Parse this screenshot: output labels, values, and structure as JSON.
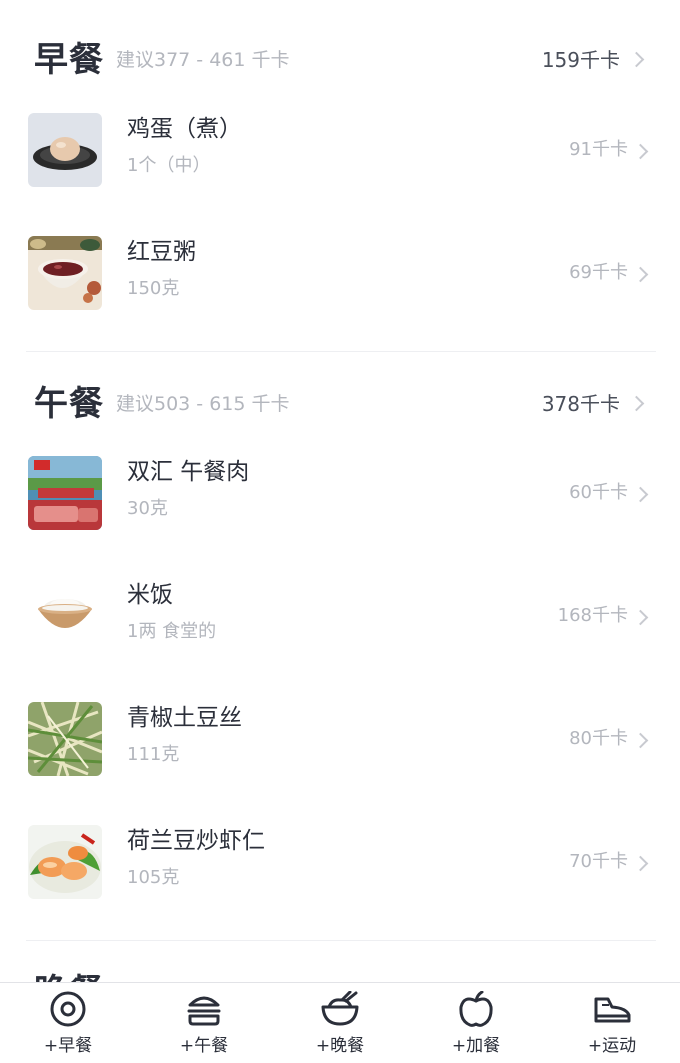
{
  "meals": {
    "breakfast": {
      "title": "早餐",
      "suggestion": "建议377 - 461 千卡",
      "total": "159千卡",
      "items": [
        {
          "name": "鸡蛋（煮）",
          "amount": "1个（中）",
          "kcal": "91千卡"
        },
        {
          "name": "红豆粥",
          "amount": "150克",
          "kcal": "69千卡"
        }
      ]
    },
    "lunch": {
      "title": "午餐",
      "suggestion": "建议503 - 615 千卡",
      "total": "378千卡",
      "items": [
        {
          "name": "双汇 午餐肉",
          "amount": "30克",
          "kcal": "60千卡"
        },
        {
          "name": "米饭",
          "amount": "1两 食堂的",
          "kcal": "168千卡"
        },
        {
          "name": "青椒土豆丝",
          "amount": "111克",
          "kcal": "80千卡"
        },
        {
          "name": "荷兰豆炒虾仁",
          "amount": "105克",
          "kcal": "70千卡"
        }
      ]
    },
    "dinner": {
      "title": "晚餐"
    }
  },
  "tabbar": {
    "items": [
      {
        "label": "+早餐",
        "icon": "breakfast-donut-icon"
      },
      {
        "label": "+午餐",
        "icon": "burger-icon"
      },
      {
        "label": "+晚餐",
        "icon": "rice-bowl-icon"
      },
      {
        "label": "+加餐",
        "icon": "apple-icon"
      },
      {
        "label": "+运动",
        "icon": "sneaker-icon"
      }
    ]
  }
}
